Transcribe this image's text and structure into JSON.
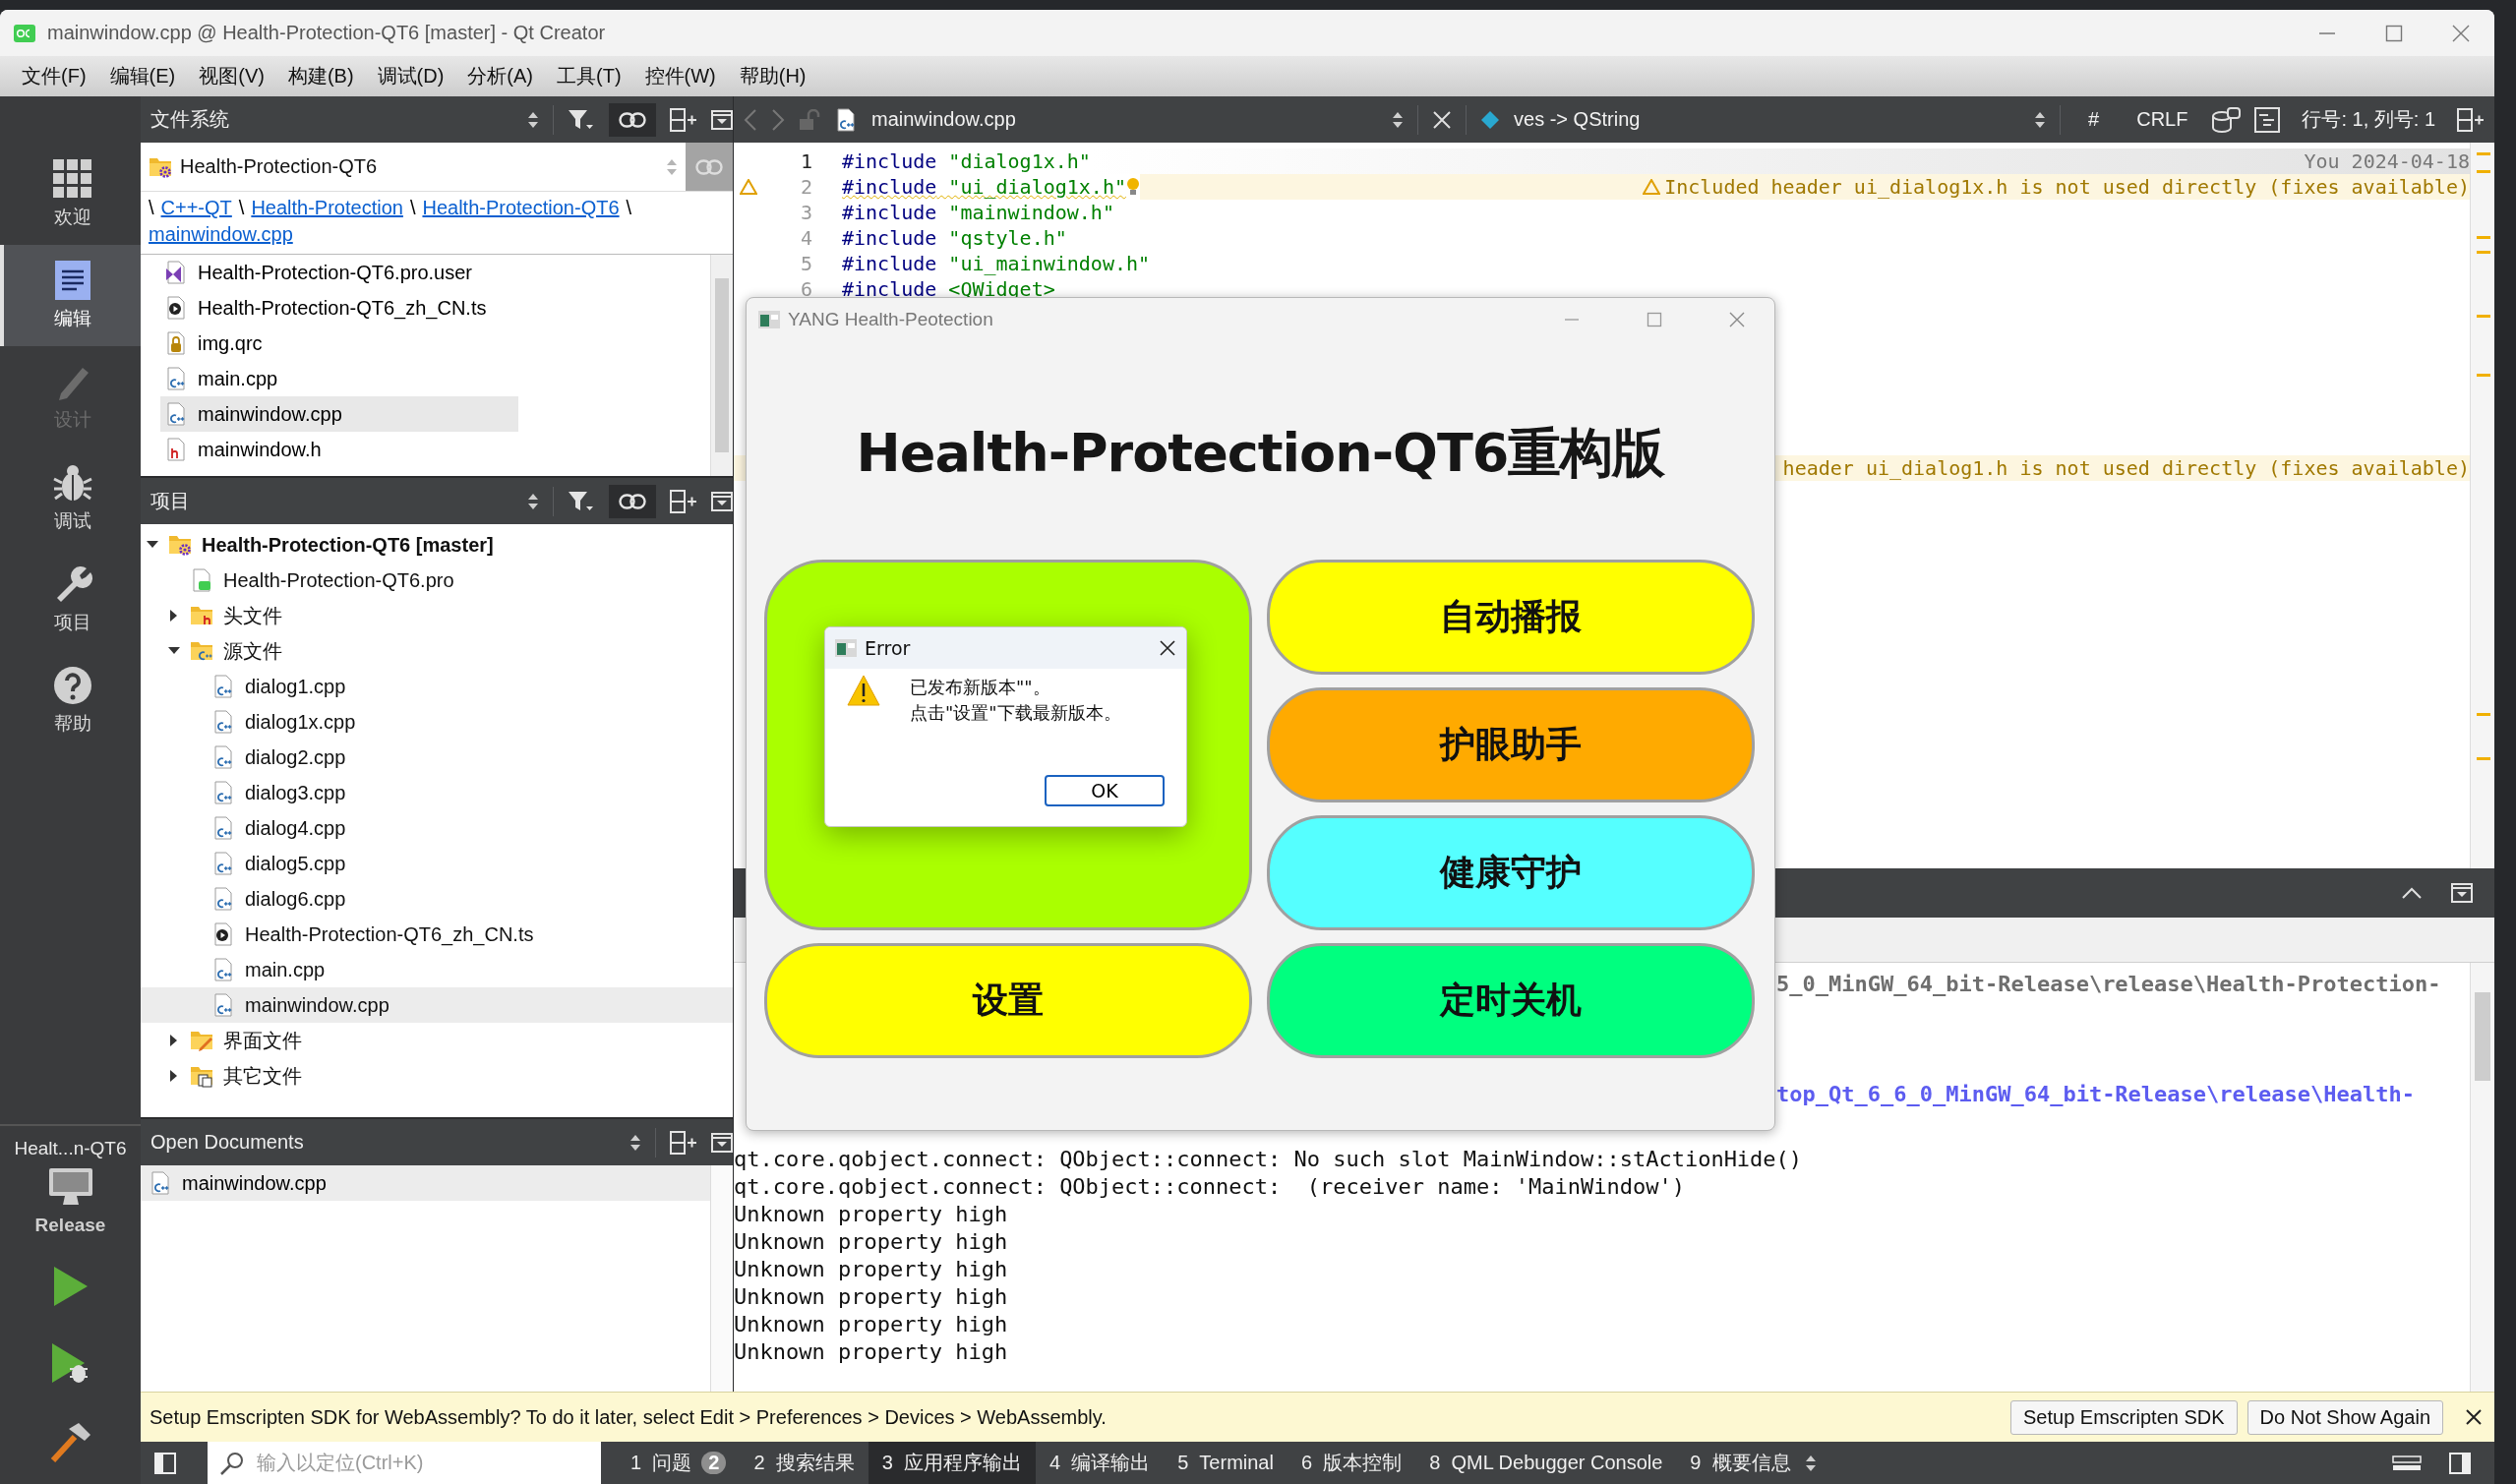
{
  "window": {
    "title": "mainwindow.cpp @ Health-Protection-QT6 [master] - Qt Creator"
  },
  "menu": [
    "文件(F)",
    "编辑(E)",
    "视图(V)",
    "构建(B)",
    "调试(D)",
    "分析(A)",
    "工具(T)",
    "控件(W)",
    "帮助(H)"
  ],
  "modes": [
    {
      "label": "欢迎",
      "selected": false,
      "disabled": false
    },
    {
      "label": "编辑",
      "selected": true,
      "disabled": false
    },
    {
      "label": "设计",
      "selected": false,
      "disabled": true
    },
    {
      "label": "调试",
      "selected": false,
      "disabled": false
    },
    {
      "label": "项目",
      "selected": false,
      "disabled": false
    },
    {
      "label": "帮助",
      "selected": false,
      "disabled": false
    }
  ],
  "kit": {
    "project": "Healt...n-QT6",
    "build_config": "Release"
  },
  "filesystem": {
    "title": "文件系统",
    "root": "Health-Protection-QT6",
    "separator": "\\",
    "breadcrumb": [
      "C++-QT",
      "Health-Protection",
      "Health-Protection-QT6",
      "mainwindow.cpp"
    ],
    "files": [
      {
        "name": "Health-Protection-QT6.pro.user",
        "kind": "user",
        "selected": false
      },
      {
        "name": "Health-Protection-QT6_zh_CN.ts",
        "kind": "ts",
        "selected": false
      },
      {
        "name": "img.qrc",
        "kind": "qrc",
        "selected": false
      },
      {
        "name": "main.cpp",
        "kind": "cpp",
        "selected": false
      },
      {
        "name": "mainwindow.cpp",
        "kind": "cpp",
        "selected": true
      },
      {
        "name": "mainwindow.h",
        "kind": "h",
        "selected": false
      }
    ]
  },
  "projects": {
    "title": "项目",
    "tree": [
      {
        "name": "Health-Protection-QT6 [master]",
        "kind": "project",
        "expanded": true,
        "selected": false,
        "children": [
          {
            "name": "Health-Protection-QT6.pro",
            "kind": "pro",
            "selected": false
          },
          {
            "name": "头文件",
            "kind": "folder-h",
            "expanded": false,
            "selected": false
          },
          {
            "name": "源文件",
            "kind": "folder-cpp",
            "expanded": true,
            "selected": false,
            "children": [
              {
                "name": "dialog1.cpp",
                "kind": "cpp",
                "selected": false
              },
              {
                "name": "dialog1x.cpp",
                "kind": "cpp",
                "selected": false
              },
              {
                "name": "dialog2.cpp",
                "kind": "cpp",
                "selected": false
              },
              {
                "name": "dialog3.cpp",
                "kind": "cpp",
                "selected": false
              },
              {
                "name": "dialog4.cpp",
                "kind": "cpp",
                "selected": false
              },
              {
                "name": "dialog5.cpp",
                "kind": "cpp",
                "selected": false
              },
              {
                "name": "dialog6.cpp",
                "kind": "cpp",
                "selected": false
              },
              {
                "name": "Health-Protection-QT6_zh_CN.ts",
                "kind": "ts",
                "selected": false
              },
              {
                "name": "main.cpp",
                "kind": "cpp",
                "selected": false
              },
              {
                "name": "mainwindow.cpp",
                "kind": "cpp",
                "selected": true
              }
            ]
          },
          {
            "name": "界面文件",
            "kind": "folder-ui",
            "expanded": false,
            "selected": false
          },
          {
            "name": "其它文件",
            "kind": "folder-other",
            "expanded": false,
            "selected": false
          }
        ]
      }
    ]
  },
  "open_documents": {
    "title": "Open Documents",
    "items": [
      {
        "name": "mainwindow.cpp",
        "selected": true
      }
    ]
  },
  "editor": {
    "file": "mainwindow.cpp",
    "symbol": "ves -> QString",
    "hash": "#",
    "line_ending": "CRLF",
    "position": "行号: 1, 列号: 1",
    "lines": [
      {
        "number": "1",
        "code": "#include \"dialog1x.h\"",
        "blame": "You 2024-04-18"
      },
      {
        "number": "2",
        "code": "#include \"ui_dialog1x.h\"",
        "warning": "Included header ui_dialog1x.h is not used directly (fixes available)"
      },
      {
        "number": "3",
        "code": "#include \"mainwindow.h\""
      },
      {
        "number": "4",
        "code": "#include \"qstyle.h\""
      },
      {
        "number": "5",
        "code": "#include \"ui_mainwindow.h\""
      },
      {
        "number": "6",
        "code": "#include <QWidget>"
      }
    ],
    "hidden_warning": "header ui_dialog1.h is not used directly (fixes available)"
  },
  "output": {
    "partial_lines": [
      {
        "text": "5_0_MinGW_64_bit-Release\\release\\Health-Protection-",
        "kind": "path"
      },
      {
        "text": "top_Qt_6_6_0_MinGW_64_bit-Release\\release\\Health-",
        "kind": "link"
      }
    ],
    "lines": [
      "qt.core.qobject.connect: QObject::connect: No such slot MainWindow::stActionHide()",
      "qt.core.qobject.connect: QObject::connect:  (receiver name: 'MainWindow')",
      "Unknown property high",
      "Unknown property high",
      "Unknown property high",
      "Unknown property high",
      "Unknown property high",
      "Unknown property high"
    ]
  },
  "info_bar": {
    "message": "Setup Emscripten SDK for WebAssembly? To do it later, select Edit > Preferences > Devices > WebAssembly.",
    "buttons": [
      "Setup Emscripten SDK",
      "Do Not Show Again"
    ]
  },
  "status_bar": {
    "search": {
      "placeholder": "输入以定位(Ctrl+K)"
    },
    "tabs": [
      {
        "number": "1",
        "label": "问题",
        "badge": "2",
        "selected": false
      },
      {
        "number": "2",
        "label": "搜索结果",
        "selected": false
      },
      {
        "number": "3",
        "label": "应用程序输出",
        "selected": true
      },
      {
        "number": "4",
        "label": "编译输出",
        "selected": false
      },
      {
        "number": "5",
        "label": "Terminal",
        "selected": false
      },
      {
        "number": "6",
        "label": "版本控制",
        "selected": false
      },
      {
        "number": "8",
        "label": "QML Debugger Console",
        "selected": false
      },
      {
        "number": "9",
        "label": "概要信息",
        "selected": false
      }
    ]
  },
  "app_dialog": {
    "title": "YANG Health-Peotection",
    "heading": "Health-Protection-QT6重构版",
    "buttons": [
      {
        "kind": "panel",
        "color": "#aaff00"
      },
      {
        "kind": "button",
        "label": "自动播报",
        "color": "#ffff00"
      },
      {
        "kind": "button",
        "label": "护眼助手",
        "color": "#ffaa00"
      },
      {
        "kind": "button",
        "label": "健康守护",
        "color": "#55ffff"
      },
      {
        "kind": "button",
        "label": "设置",
        "color": "#ffff00"
      },
      {
        "kind": "button",
        "label": "定时关机",
        "color": "#00ff7f"
      }
    ]
  },
  "message_box": {
    "title": "Error",
    "lines": [
      "已发布新版本\"\"。",
      "点击\"设置\"下载最新版本。"
    ],
    "button": "OK"
  }
}
